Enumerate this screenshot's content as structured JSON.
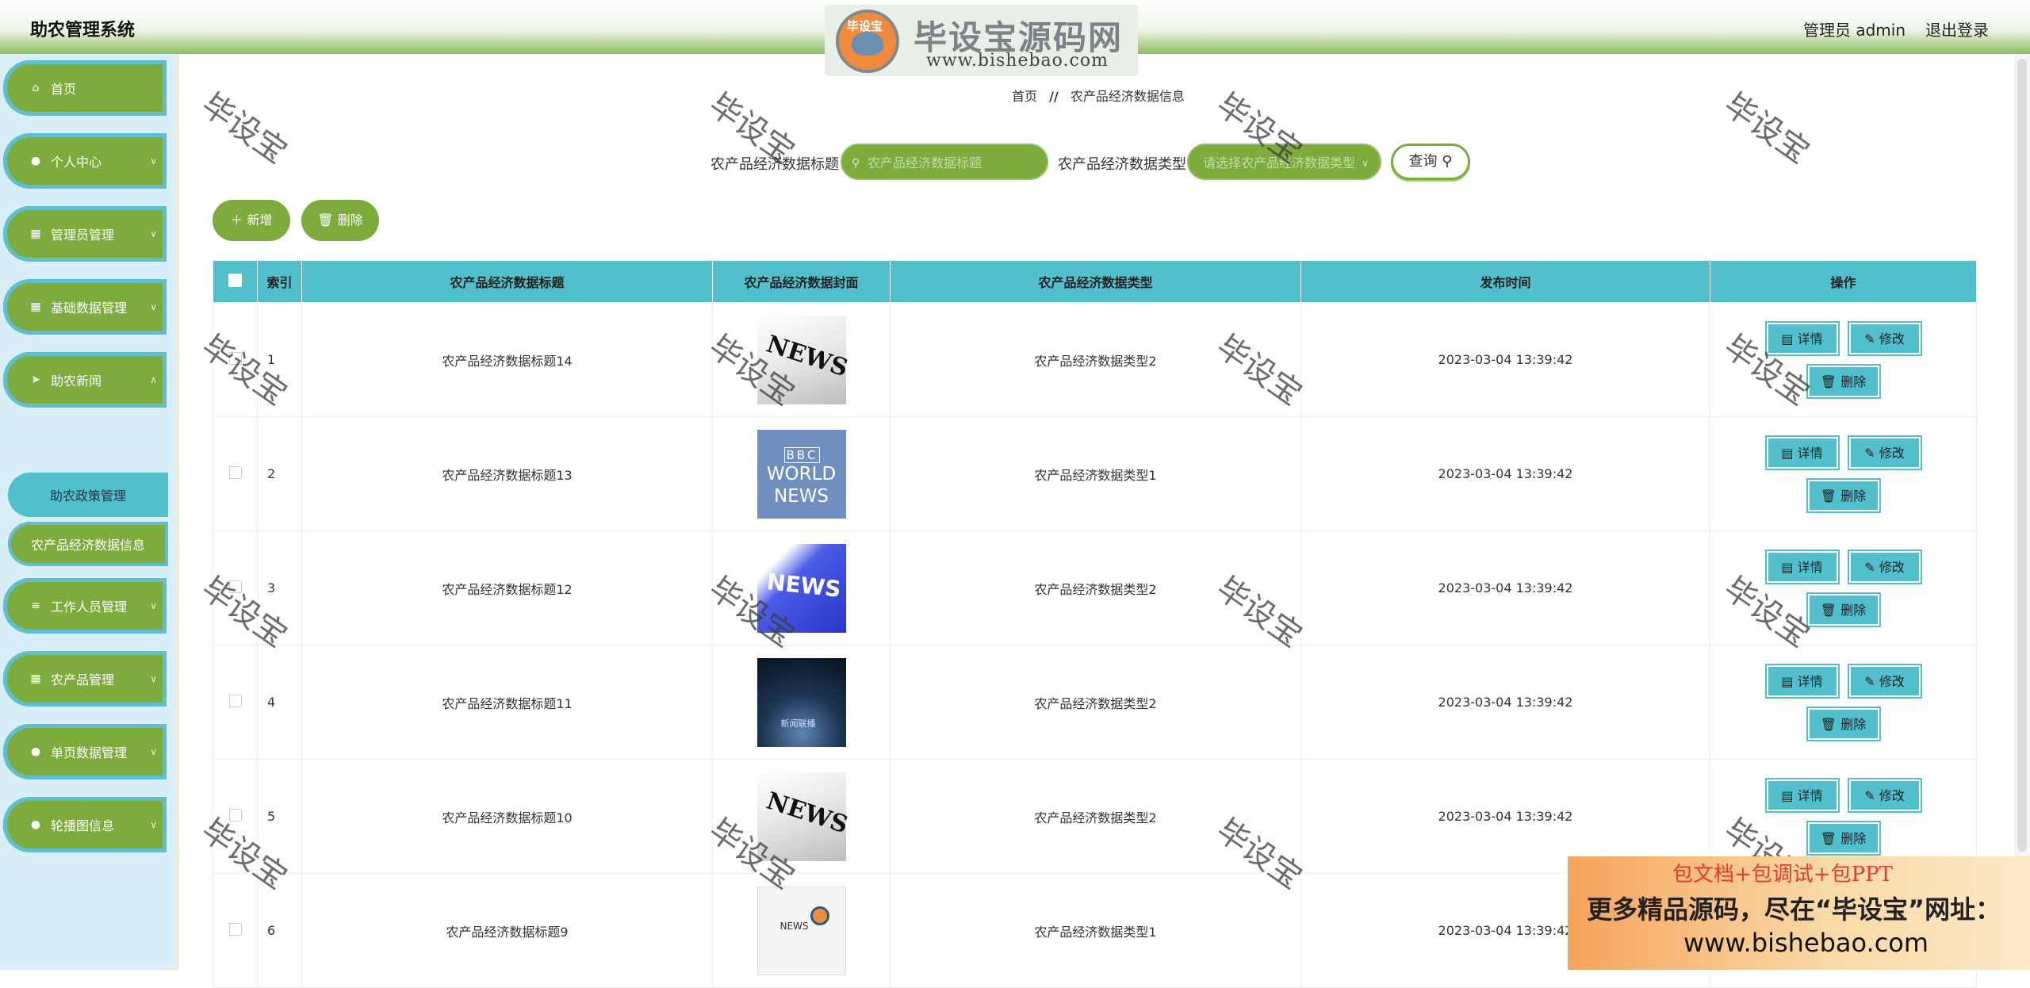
{
  "header": {
    "title": "助农管理系统",
    "logo_badge": "毕设宝",
    "logo_text": "毕设宝源码网",
    "logo_url": "www.bishebao.com",
    "admin_label": "管理员 admin",
    "logout_label": "退出登录"
  },
  "sidebar": {
    "items": [
      {
        "label": "首页",
        "icon": "home-icon"
      },
      {
        "label": "个人中心",
        "icon": "user-icon"
      },
      {
        "label": "管理员管理",
        "icon": "grid-icon"
      },
      {
        "label": "基础数据管理",
        "icon": "grid-icon"
      },
      {
        "label": "助农新闻",
        "icon": "send-icon"
      },
      {
        "label": "工作人员管理",
        "icon": "list-icon"
      },
      {
        "label": "农产品管理",
        "icon": "grid-icon"
      },
      {
        "label": "单页数据管理",
        "icon": "pin-icon"
      },
      {
        "label": "轮播图信息",
        "icon": "user-icon"
      }
    ],
    "sub_items": [
      "助农政策管理",
      "农产品经济数据信息"
    ]
  },
  "breadcrumb": {
    "home": "首页",
    "separator": "//",
    "current": "农产品经济数据信息"
  },
  "search": {
    "title_label": "农产品经济数据标题",
    "title_placeholder": "农产品经济数据标题",
    "type_label": "农产品经济数据类型",
    "type_placeholder": "请选择农产品经济数据类型",
    "query_label": "查询"
  },
  "toolbar": {
    "add_label": "新增",
    "delete_label": "删除"
  },
  "table": {
    "columns": [
      "索引",
      "农产品经济数据标题",
      "农产品经济数据封面",
      "农产品经济数据类型",
      "发布时间",
      "操作"
    ],
    "rows": [
      {
        "index": "1",
        "title": "农产品经济数据标题14",
        "cover": "NEWS",
        "type": "农产品经济数据类型2",
        "time": "2023-03-04 13:39:42"
      },
      {
        "index": "2",
        "title": "农产品经济数据标题13",
        "cover": "BBC WORLD NEWS",
        "type": "农产品经济数据类型1",
        "time": "2023-03-04 13:39:42"
      },
      {
        "index": "3",
        "title": "农产品经济数据标题12",
        "cover": "NEWS",
        "type": "农产品经济数据类型2",
        "time": "2023-03-04 13:39:42"
      },
      {
        "index": "4",
        "title": "农产品经济数据标题11",
        "cover": "新闻联播",
        "type": "农产品经济数据类型2",
        "time": "2023-03-04 13:39:42"
      },
      {
        "index": "5",
        "title": "农产品经济数据标题10",
        "cover": "NEWS",
        "type": "农产品经济数据类型2",
        "time": "2023-03-04 13:39:42"
      },
      {
        "index": "6",
        "title": "农产品经济数据标题9",
        "cover": "NEWS",
        "type": "农产品经济数据类型1",
        "time": "2023-03-04 13:39:42"
      }
    ],
    "op_labels": {
      "detail": "详情",
      "edit": "修改",
      "delete": "删除"
    }
  },
  "watermark": "毕设宝",
  "promo": {
    "line1": "包文档+包调试+包PPT",
    "line2": "更多精品源码，尽在“毕设宝”网址：",
    "line3": "www.bishebao.com"
  },
  "colors": {
    "accent_green": "#7dab3c",
    "accent_teal": "#52bfcd",
    "sidebar_bg": "#d8eff7"
  }
}
